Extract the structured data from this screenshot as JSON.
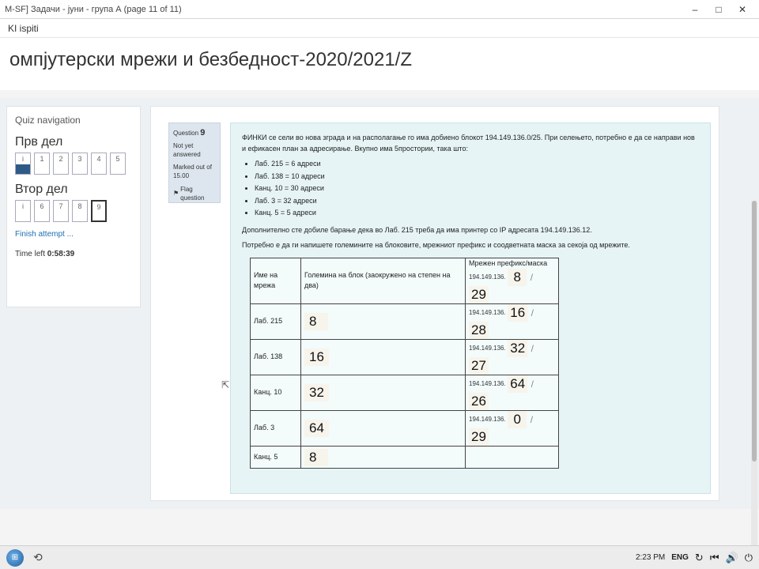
{
  "window": {
    "title": "M-SF] Задачи - јуни - група А (page 11 of 11)",
    "minimize_icon": "minimize-icon",
    "maximize_icon": "maximize-icon",
    "close_icon": "close-icon",
    "minimize_glyph": "–",
    "maximize_glyph": "□",
    "close_glyph": "✕"
  },
  "site": {
    "name": "KI ispiti"
  },
  "course": {
    "title": "омпјутерски мрежи и безбедност-2020/2021/Z"
  },
  "quiz_nav": {
    "title": "Quiz navigation",
    "sections": [
      {
        "title": "Прв дел",
        "questions": [
          "i",
          "1",
          "2",
          "3",
          "4",
          "5"
        ]
      },
      {
        "title": "Втор дел",
        "questions": [
          "i",
          "6",
          "7",
          "8",
          "9"
        ]
      }
    ],
    "finish_label": "Finish attempt ...",
    "time_left_label": "Time left",
    "time_left_value": "0:58:39"
  },
  "question_info": {
    "label": "Question",
    "number": "9",
    "state": "Not yet answered",
    "mark": "Marked out of 15.00",
    "flag_label": "Flag question",
    "flag_icon": "flag-icon"
  },
  "question": {
    "intro": "ФИНКИ се сели во нова зграда и на располагање го има добиено блокот 194.149.136.0/25. При селењето, потребно е да се направи нов и ефикасен план за адресирање. Вкупно има 5простории, така што:",
    "rooms": [
      "Лаб. 215 = 6 адреси",
      "Лаб. 138 = 10 адреси",
      "Канц. 10 = 30 адреси",
      "Лаб. 3 = 32 адреси",
      "Канц. 5 = 5 адреси"
    ],
    "extra": "Дополнително сте добиле барање дека во Лаб. 215 треба да има принтер со IP адресата 194.149.136.12.",
    "task": "Потребно е да ги напишете големините на блоковите, мрежниот префикс и соодветната маска за секоја од мрежите."
  },
  "answer_table": {
    "headers": [
      "Име на мрежа",
      "Големина на блок (заокружено на степен на два)",
      "Мрежен префикс/маска"
    ],
    "prefix_text": "194.149.136.",
    "slash": "/",
    "first_row_block": "8",
    "rows": [
      {
        "name": "",
        "block": "",
        "octet": "8",
        "mask": "29"
      },
      {
        "name": "Лаб. 215",
        "block": "8",
        "octet": "16",
        "mask": "28"
      },
      {
        "name": "Лаб. 138",
        "block": "16",
        "octet": "32",
        "mask": "27"
      },
      {
        "name": "Канц. 10",
        "block": "32",
        "octet": "64",
        "mask": "26"
      },
      {
        "name": "Лаб. 3",
        "block": "64",
        "octet": "0",
        "mask": "29"
      },
      {
        "name": "Канц. 5",
        "block": "8",
        "octet": "",
        "mask": ""
      }
    ]
  },
  "taskbar": {
    "time": "2:23 PM",
    "lang": "ENG",
    "start_icon": "windows-start-icon",
    "app_icon": "app-icon",
    "refresh_icon": "refresh-icon",
    "back_icon": "back-icon",
    "volume_icon": "volume-icon",
    "power_icon": "power-icon",
    "refresh_glyph": "↻",
    "back_glyph": "⏮",
    "volume_glyph": "🔊",
    "power_glyph": "⏻",
    "app_glyph": "⟲",
    "start_glyph": "⊞"
  }
}
